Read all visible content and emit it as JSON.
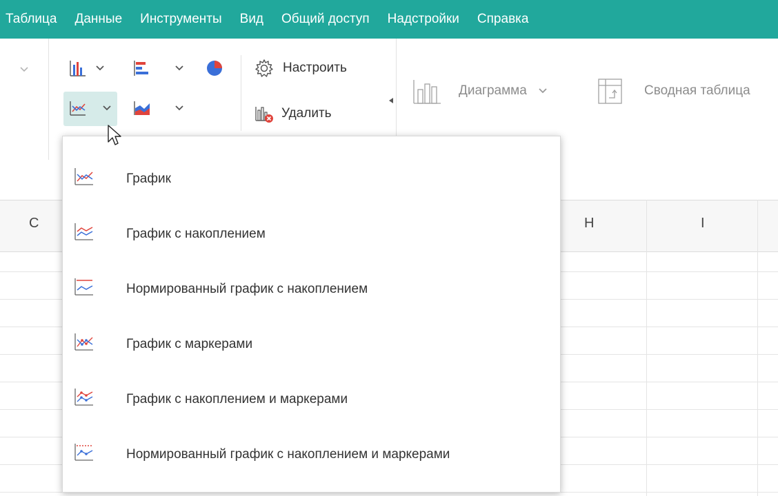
{
  "menubar": {
    "items": [
      "Таблица",
      "Данные",
      "Инструменты",
      "Вид",
      "Общий доступ",
      "Надстройки",
      "Справка"
    ]
  },
  "ribbon": {
    "configure_label": "Настроить",
    "delete_label": "Удалить",
    "chart_label": "Диаграмма",
    "pivot_label": "Сводная таблица"
  },
  "columns": {
    "c": "C",
    "h": "H",
    "i": "I"
  },
  "dropdown": {
    "items": [
      {
        "label": "График",
        "icon": "line-chart-icon"
      },
      {
        "label": "График с накоплением",
        "icon": "stacked-line-chart-icon"
      },
      {
        "label": "Нормированный график с накоплением",
        "icon": "percent-stacked-line-chart-icon"
      },
      {
        "label": "График с маркерами",
        "icon": "line-markers-chart-icon"
      },
      {
        "label": "График с накоплением и маркерами",
        "icon": "stacked-line-markers-chart-icon"
      },
      {
        "label": "Нормированный график с накоплением и маркерами",
        "icon": "percent-stacked-line-markers-chart-icon"
      }
    ]
  },
  "colors": {
    "menubar_bg": "#21a89c",
    "highlight_bg": "#d6ebe9",
    "chart_blue": "#3a6fd8",
    "chart_red": "#e0443c"
  }
}
